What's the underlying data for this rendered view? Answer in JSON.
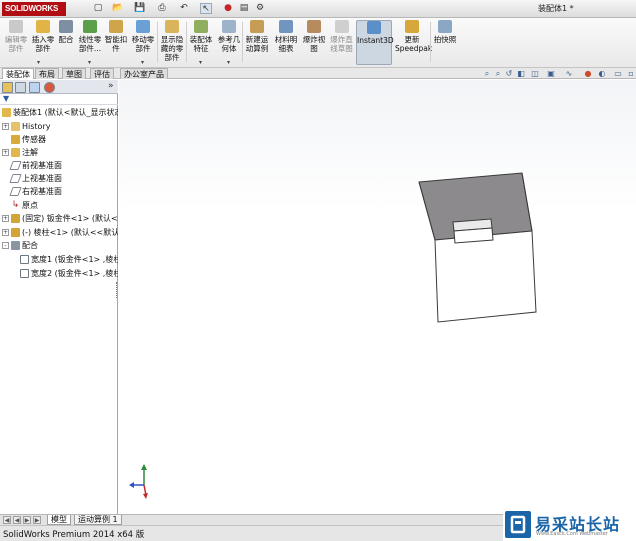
{
  "app": {
    "logo_text": "SOLIDWORKS",
    "document_title": "装配体1 *"
  },
  "ribbon": {
    "buttons": [
      {
        "label": "编辑零\n部件",
        "icon": "edit-component-icon",
        "disabled": true
      },
      {
        "label": "插入零\n部件",
        "icon": "insert-components-icon"
      },
      {
        "label": "配合",
        "icon": "mate-icon"
      },
      {
        "label": "线性零\n部件...",
        "icon": "linear-pattern-icon"
      },
      {
        "label": "智能扣\n件",
        "icon": "smart-fasteners-icon"
      },
      {
        "label": "移动零\n部件",
        "icon": "move-component-icon"
      },
      {
        "label": "显示隐\n藏的零\n部件",
        "icon": "show-hidden-icon"
      },
      {
        "label": "装配体\n特征",
        "icon": "assembly-features-icon"
      },
      {
        "label": "参考几\n何体",
        "icon": "reference-geometry-icon"
      },
      {
        "label": "新建运\n动算例",
        "icon": "new-motion-study-icon"
      },
      {
        "label": "材料明\n细表",
        "icon": "bom-icon"
      },
      {
        "label": "爆炸视\n图",
        "icon": "exploded-view-icon"
      },
      {
        "label": "爆炸直\n线草图",
        "icon": "explode-line-sketch-icon",
        "disabled": true
      },
      {
        "label": "Instant3D",
        "icon": "instant3d-icon",
        "active": true
      },
      {
        "label": "更新\nSpeedpak",
        "icon": "speedpak-icon"
      },
      {
        "label": "拍快照",
        "icon": "snapshot-icon"
      }
    ]
  },
  "command_tabs": [
    "装配体",
    "布局",
    "草图",
    "评估",
    "办公室产品"
  ],
  "feature_tree": {
    "root": "装配体1 (默认<默认_显示状态",
    "items": [
      {
        "label": "History",
        "icon": "history-icon",
        "expander": "+"
      },
      {
        "label": "传感器",
        "icon": "sensors-icon",
        "expander": ""
      },
      {
        "label": "注解",
        "icon": "annotations-icon",
        "expander": "+"
      },
      {
        "label": "前视基准面",
        "icon": "plane-icon",
        "expander": ""
      },
      {
        "label": "上视基准面",
        "icon": "plane-icon",
        "expander": ""
      },
      {
        "label": "右视基准面",
        "icon": "plane-icon",
        "expander": ""
      },
      {
        "label": "原点",
        "icon": "origin-icon",
        "expander": ""
      },
      {
        "label": "(固定) 钣金件<1> (默认<<",
        "icon": "part-icon",
        "expander": "+"
      },
      {
        "label": "(-) 棱柱<1> (默认<<默认>",
        "icon": "part-icon",
        "expander": "+"
      },
      {
        "label": "配合",
        "icon": "mates-icon",
        "expander": "-"
      },
      {
        "label": "宽度1 (钣金件<1> ,棱柱",
        "icon": "width-mate-icon",
        "expander": ""
      },
      {
        "label": "宽度2 (钣金件<1> ,棱柱",
        "icon": "width-mate-icon",
        "expander": ""
      }
    ]
  },
  "bottom_tabs": [
    "模型",
    "运动算例 1"
  ],
  "status": {
    "text": "SolidWorks Premium 2014 x64 版"
  },
  "watermark": {
    "cn": "易采站长站",
    "en": "Www.Easck.Com Webmaster"
  },
  "colors": {
    "brand": "#b10e14",
    "selection": "#cdd7e2",
    "part_top": "#8c8a8c",
    "part_front": "#ffffff"
  }
}
